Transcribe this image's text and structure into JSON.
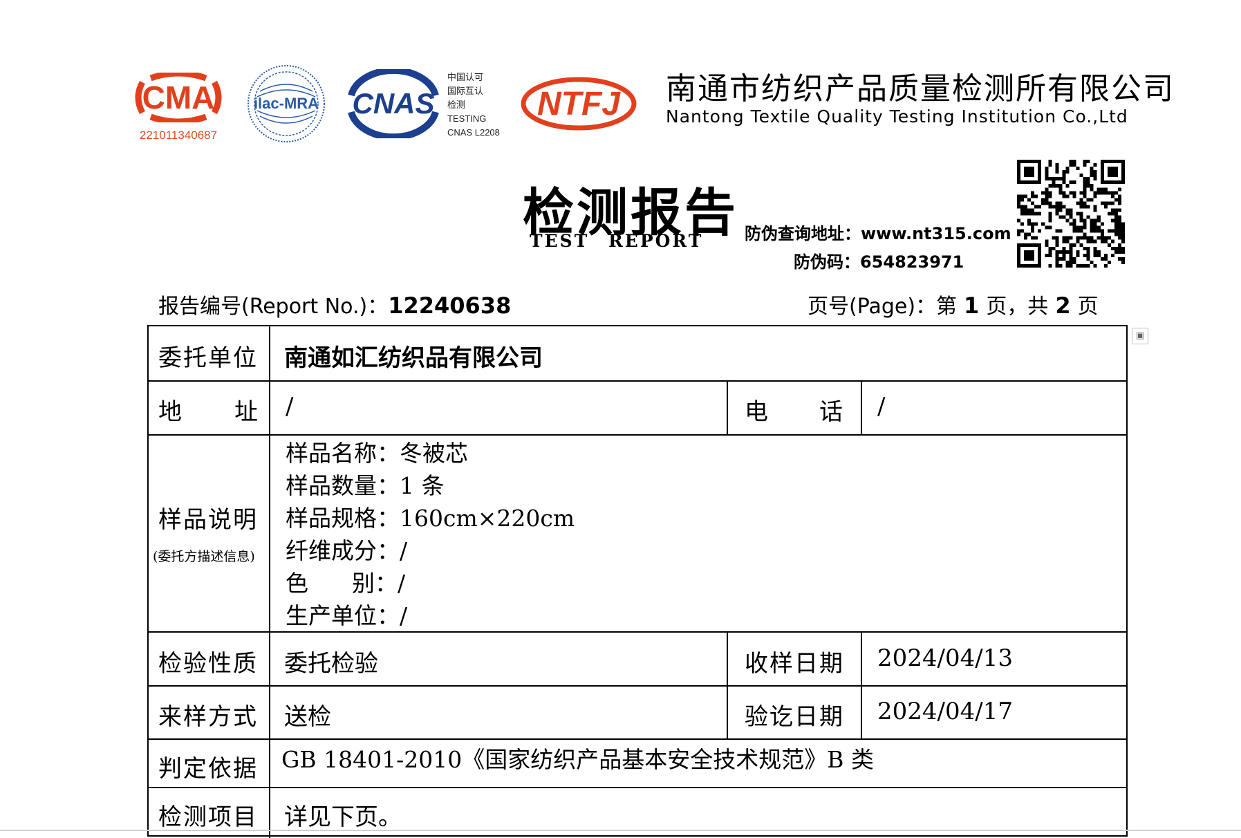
{
  "header": {
    "cma_mark": "CMA",
    "cma_number": "221011340687",
    "ilac_mark": "ilac-MRA",
    "cnas_mark": "CNAS",
    "cnas_text": [
      "中国认可",
      "国际互认",
      "检测",
      "TESTING",
      "CNAS L2208"
    ],
    "ntfj_mark": "NTFJ",
    "company_cn": "南通市纺织产品质量检测所有限公司",
    "company_en": "Nantong Textile Quality Testing Institution Co.,Ltd"
  },
  "title": {
    "cn": "检测报告",
    "en": "TEST REPORT"
  },
  "verify": {
    "url_label": "防伪查询地址：",
    "url": "www.nt315.com",
    "code_label": "防伪码：",
    "code": "654823971"
  },
  "report": {
    "no_label": "报告编号(Report No.)：",
    "no": "12240638",
    "page_label": "页号(Page)：第",
    "page_current": "1",
    "page_mid": "页，共",
    "page_total": "2",
    "page_end": "页"
  },
  "table": {
    "client_label": "委托单位",
    "client_value": "南通如汇纺织品有限公司",
    "address_label_a": "地",
    "address_label_b": "址",
    "address_value": "/",
    "phone_label_a": "电",
    "phone_label_b": "话",
    "phone_value": "/",
    "sample_label": "样品说明",
    "sample_sublabel": "(委托方描述信息)",
    "sample_lines": [
      "样品名称：冬被芯",
      "样品数量：1 条",
      "样品规格：160cm×220cm",
      "纤维成分：/",
      "色      别：/",
      "生产单位：/"
    ],
    "nature_label": "检验性质",
    "nature_value": "委托检验",
    "receive_label": "收样日期",
    "receive_value": "2024/04/13",
    "delivery_label": "来样方式",
    "delivery_value": "送检",
    "end_label": "验讫日期",
    "end_value": "2024/04/17",
    "basis_label": "判定依据",
    "basis_value": "GB 18401-2010《国家纺织产品基本安全技术规范》B 类",
    "items_label": "检测项目",
    "items_value": "详见下页。"
  },
  "colors": {
    "logo_red": "#e2401c",
    "cnas_blue": "#1c3f8f",
    "ilac_blue": "#2b5ba8"
  }
}
